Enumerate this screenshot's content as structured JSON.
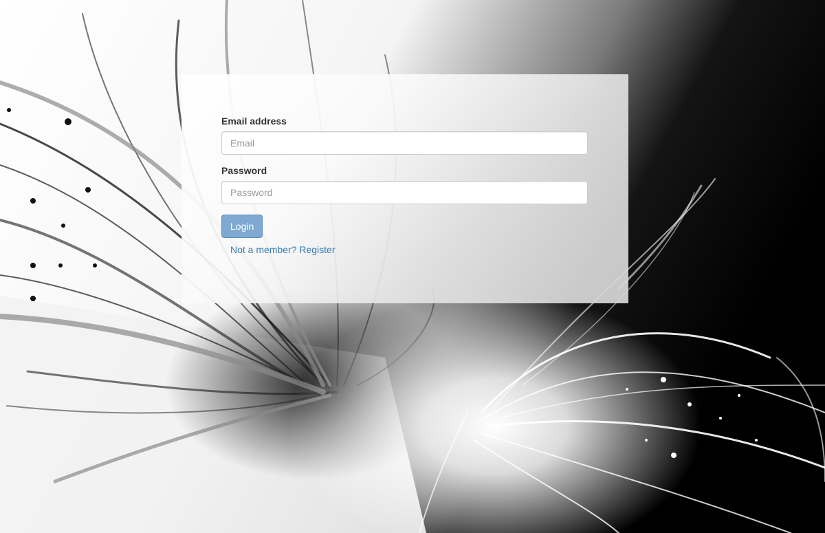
{
  "login_form": {
    "email": {
      "label": "Email address",
      "placeholder": "Email",
      "value": ""
    },
    "password": {
      "label": "Password",
      "placeholder": "Password",
      "value": ""
    },
    "login_button": {
      "label": "Login"
    },
    "register_link": {
      "label": "Not a member? Register"
    }
  },
  "colors": {
    "button_background": "#7eaad2",
    "link": "#337ab7",
    "label_text": "#333333"
  }
}
